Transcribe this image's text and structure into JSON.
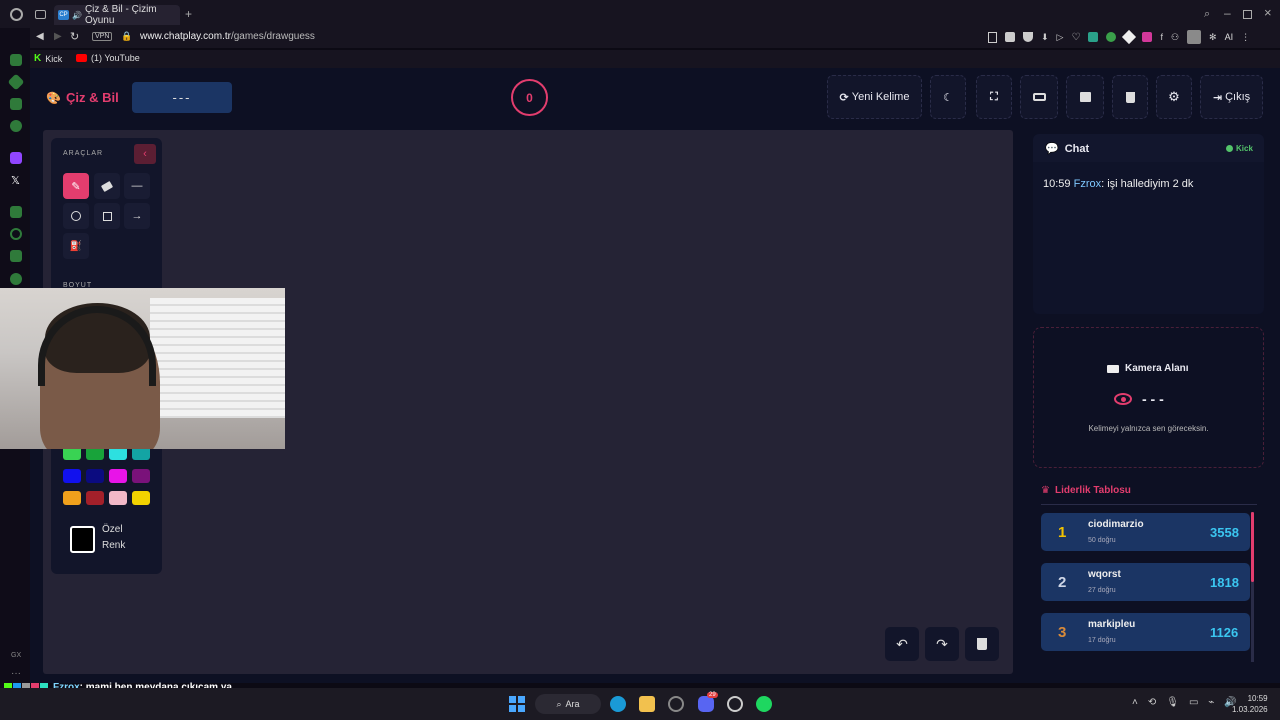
{
  "browser": {
    "tab_title": "Çiz & Bil - Çizim Oyunu",
    "tab_badge": "CP",
    "url_domain": "www.chatplay.com.tr",
    "url_path": "/games/drawguess",
    "vpn_label": "VPN",
    "ai_label": "AI",
    "gx_label": "GX",
    "bookmarks": [
      {
        "label": "Kick",
        "icon": "kick-icon",
        "color": "#53fc18"
      },
      {
        "label": "(1) YouTube",
        "icon": "youtube-icon",
        "color": "#ff0000"
      }
    ]
  },
  "app": {
    "title": "Çiz & Bil",
    "accent": "#e33d6e",
    "word_display": "---",
    "timer": "0",
    "toolbar": {
      "new_word": "Yeni Kelime",
      "exit": "Çıkış"
    },
    "tools": {
      "title": "ARAÇLAR",
      "size_title": "BOYUT",
      "custom_color_line1": "Özel",
      "custom_color_line2": "Renk",
      "palette": [
        "#39d353",
        "#18a33a",
        "#2de0e0",
        "#13a4a4",
        "#1111ee",
        "#0b0b80",
        "#e814e8",
        "#7a127a",
        "#f0a01c",
        "#a3202a",
        "#f2b8c8",
        "#f2d200"
      ]
    },
    "chat": {
      "title": "Chat",
      "source": "Kick",
      "messages": [
        {
          "time": "10:59",
          "user": "Fzrox",
          "text": ": işi hallediyim 2 dk"
        }
      ]
    },
    "camera": {
      "title": "Kamera Alanı",
      "word": "- - -",
      "hint": "Kelimeyi yalnızca sen göreceksin."
    },
    "leaderboard": {
      "title": "Liderlik Tablosu",
      "rows": [
        {
          "rank": "1",
          "name": "ciodimarzio",
          "sub": "50 doğru",
          "score": "3558",
          "rank_color": "#f2c200"
        },
        {
          "rank": "2",
          "name": "wqorst",
          "sub": "27 doğru",
          "score": "1818",
          "rank_color": "#cfd6e6"
        },
        {
          "rank": "3",
          "name": "markipleu",
          "sub": "17 doğru",
          "score": "1126",
          "rank_color": "#d88a3a"
        }
      ]
    }
  },
  "stream_chat": {
    "user": "Fzrox",
    "text": ": mami ben meydana çıkıcam ya"
  },
  "taskbar": {
    "search": "Ara",
    "time": "10:59",
    "date": "1.03.2026",
    "badge_count": "29"
  }
}
